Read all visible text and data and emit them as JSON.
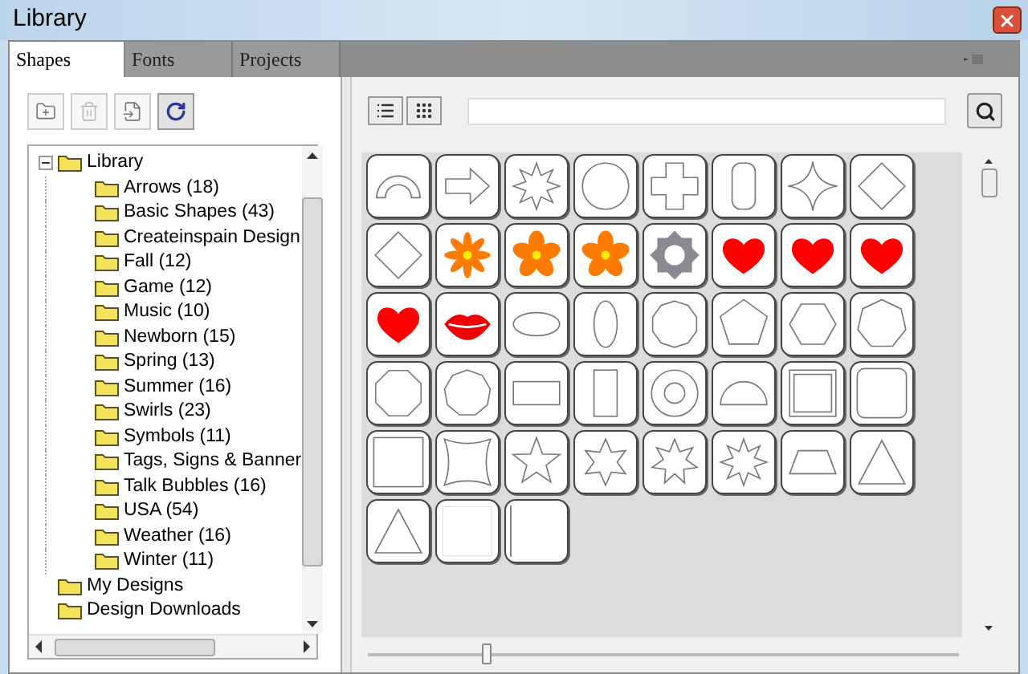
{
  "window": {
    "title": "Library"
  },
  "tabs": [
    {
      "label": "Shapes",
      "selected": true
    },
    {
      "label": "Fonts",
      "selected": false
    },
    {
      "label": "Projects",
      "selected": false
    }
  ],
  "toolbar": [
    {
      "kind": "new-folder",
      "disabled": false
    },
    {
      "kind": "delete",
      "disabled": true
    },
    {
      "kind": "import",
      "disabled": false
    },
    {
      "kind": "refresh",
      "disabled": false
    }
  ],
  "tree": [
    {
      "label": "Library",
      "expanded": true,
      "children": [
        {
          "label": "Arrows (18)"
        },
        {
          "label": "Basic Shapes (43)"
        },
        {
          "label": "Createinspain Design"
        },
        {
          "label": "Fall (12)"
        },
        {
          "label": "Game (12)"
        },
        {
          "label": "Music (10)"
        },
        {
          "label": "Newborn (15)"
        },
        {
          "label": "Spring (13)"
        },
        {
          "label": "Summer (16)"
        },
        {
          "label": "Swirls (23)"
        },
        {
          "label": "Symbols (11)"
        },
        {
          "label": "Tags, Signs & Banner"
        },
        {
          "label": "Talk Bubbles (16)"
        },
        {
          "label": "USA (54)"
        },
        {
          "label": "Weather (16)"
        },
        {
          "label": "Winter (11)"
        }
      ]
    },
    {
      "label": "My Designs"
    },
    {
      "label": "Design Downloads"
    }
  ],
  "view_buttons": [
    {
      "kind": "list",
      "selected": false
    },
    {
      "kind": "grid",
      "selected": false
    }
  ],
  "shapes": [
    {
      "kind": "arc"
    },
    {
      "kind": "arrow"
    },
    {
      "kind": "asterisk"
    },
    {
      "kind": "circle"
    },
    {
      "kind": "cross"
    },
    {
      "kind": "pill"
    },
    {
      "kind": "star4"
    },
    {
      "kind": "diamond"
    },
    {
      "kind": "diamond"
    },
    {
      "kind": "flower8"
    },
    {
      "kind": "flower5"
    },
    {
      "kind": "flower5"
    },
    {
      "kind": "gear"
    },
    {
      "kind": "heart"
    },
    {
      "kind": "heart"
    },
    {
      "kind": "heart"
    },
    {
      "kind": "heart"
    },
    {
      "kind": "lips"
    },
    {
      "kind": "ellipse-wide"
    },
    {
      "kind": "ellipse-tall"
    },
    {
      "kind": "decagon"
    },
    {
      "kind": "pentagon"
    },
    {
      "kind": "hexagon"
    },
    {
      "kind": "heptagon"
    },
    {
      "kind": "octagon"
    },
    {
      "kind": "nonagon"
    },
    {
      "kind": "rectangle-wide"
    },
    {
      "kind": "rectangle-tall"
    },
    {
      "kind": "ring"
    },
    {
      "kind": "half-circle"
    },
    {
      "kind": "square-frame"
    },
    {
      "kind": "rounded-square"
    },
    {
      "kind": "square"
    },
    {
      "kind": "star4-concave"
    },
    {
      "kind": "star5"
    },
    {
      "kind": "star6"
    },
    {
      "kind": "star7"
    },
    {
      "kind": "star8"
    },
    {
      "kind": "trapezoid"
    },
    {
      "kind": "triangle"
    },
    {
      "kind": "triangle"
    },
    {
      "kind": "blank"
    },
    {
      "kind": "line"
    }
  ],
  "zoom_slider": {
    "level": 0.2
  }
}
